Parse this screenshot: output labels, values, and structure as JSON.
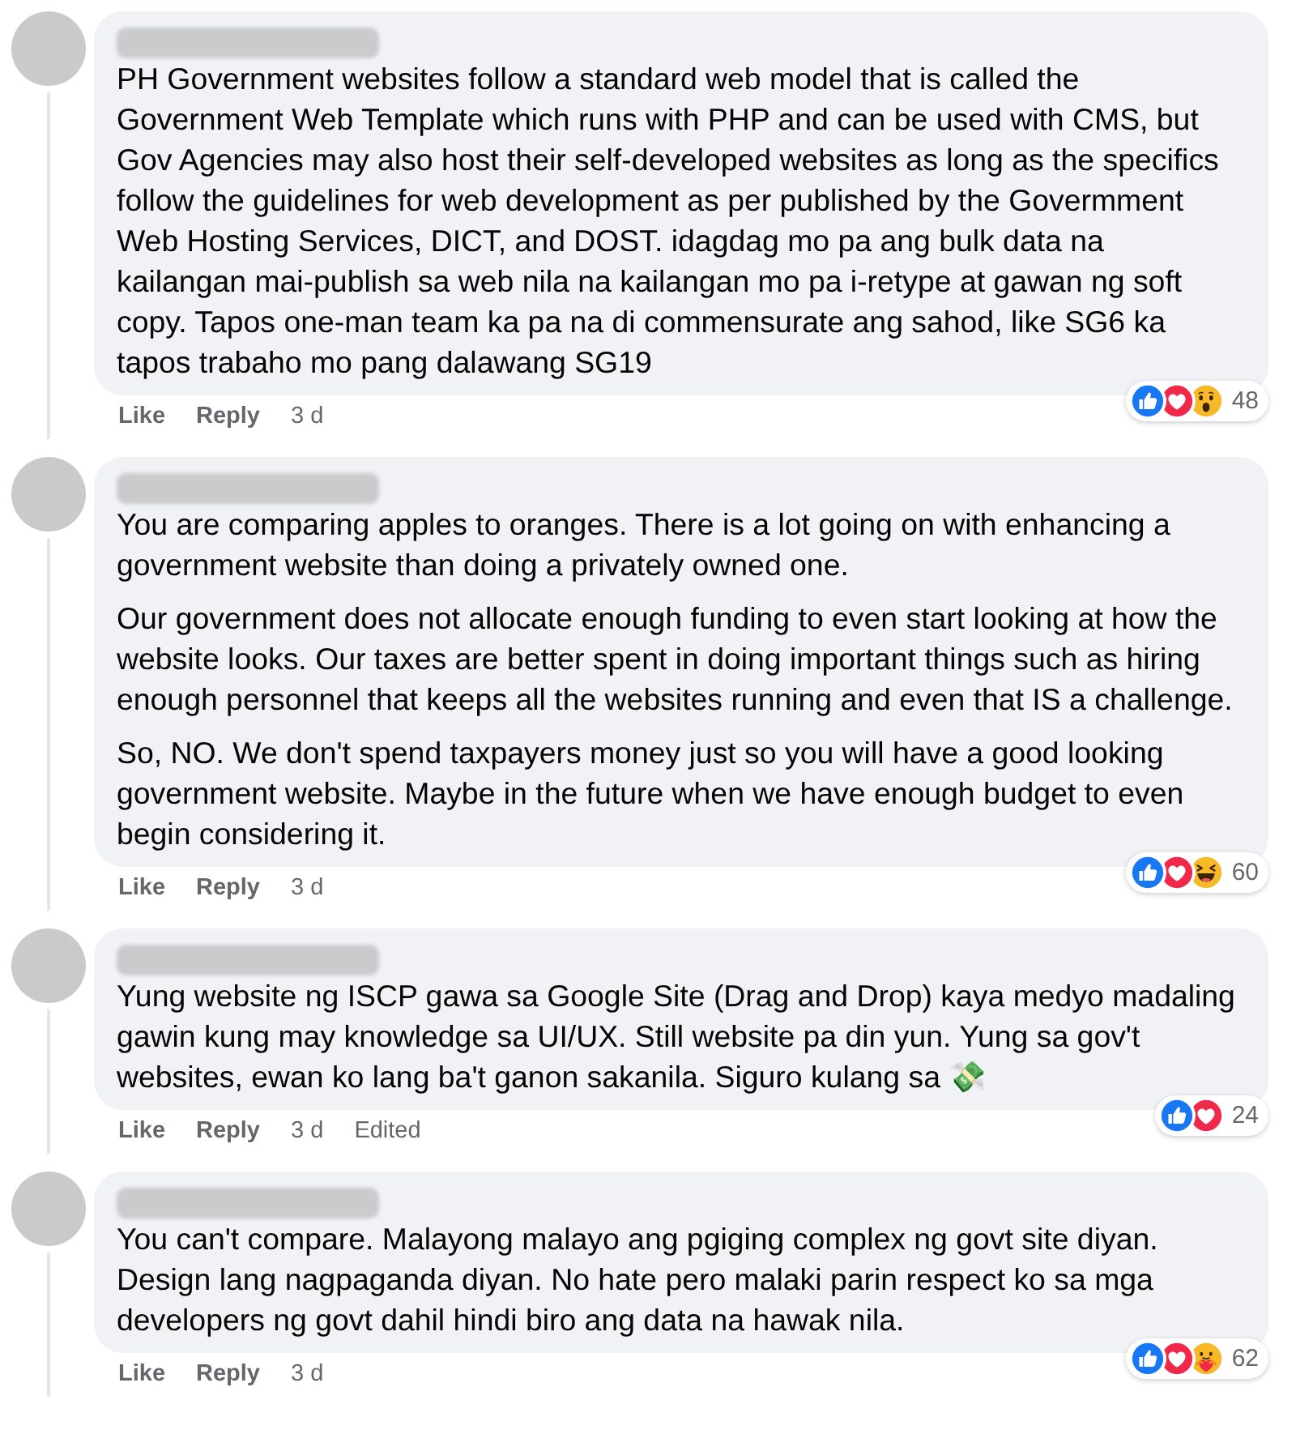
{
  "comments": [
    {
      "paragraphs": [
        {
          "text": "PH Government websites follow a standard web model that is called the Government Web Template which runs with PHP and can be used with CMS, but Gov Agencies may also host their self-developed websites as long as the specifics follow the guidelines for web development as per published by the Govermment Web Hosting Services, DICT, and DOST. idagdag mo pa ang bulk data na kailangan mai-publish sa web nila na kailangan mo pa i-retype at gawan ng soft copy. Tapos one-man team ka pa na di commensurate ang sahod, like SG6 ka tapos trabaho mo pang dalawang SG19"
        }
      ],
      "actions": [
        {
          "label": "Like",
          "kind": "link"
        },
        {
          "label": "Reply",
          "kind": "link"
        },
        {
          "label": "3 d",
          "kind": "meta"
        }
      ],
      "reactions": {
        "items": [
          {
            "kind": "like"
          },
          {
            "kind": "love"
          },
          {
            "kind": "wow"
          }
        ],
        "count": "48"
      }
    },
    {
      "paragraphs": [
        {
          "text": "You are comparing apples to oranges. There is a lot going on with enhancing a government website than doing a privately owned one."
        },
        {
          "text": "Our government does not allocate enough funding to even start looking at how the website looks. Our taxes are better spent in doing important things such as hiring enough personnel that keeps all the websites running and even that IS a challenge."
        },
        {
          "text": "So, NO. We don't spend taxpayers money just so you will have a good looking government website. Maybe in the future when we have enough budget to even begin considering it."
        }
      ],
      "actions": [
        {
          "label": "Like",
          "kind": "link"
        },
        {
          "label": "Reply",
          "kind": "link"
        },
        {
          "label": "3 d",
          "kind": "meta"
        }
      ],
      "reactions": {
        "items": [
          {
            "kind": "like"
          },
          {
            "kind": "love"
          },
          {
            "kind": "haha"
          }
        ],
        "count": "60"
      }
    },
    {
      "paragraphs": [
        {
          "text": "Yung website ng ISCP gawa sa Google Site (Drag and Drop) kaya medyo madaling gawin kung may knowledge sa UI/UX. Still website pa din yun. Yung sa gov't websites, ewan ko lang ba't ganon sakanila. Siguro kulang sa 💸"
        }
      ],
      "actions": [
        {
          "label": "Like",
          "kind": "link"
        },
        {
          "label": "Reply",
          "kind": "link"
        },
        {
          "label": "3 d",
          "kind": "meta"
        },
        {
          "label": "Edited",
          "kind": "meta"
        }
      ],
      "reactions": {
        "items": [
          {
            "kind": "like"
          },
          {
            "kind": "love"
          }
        ],
        "count": "24"
      }
    },
    {
      "paragraphs": [
        {
          "text": "You can't compare. Malayong malayo ang pgiging complex ng govt site diyan. Design lang nagpaganda diyan. No hate pero malaki parin respect ko sa mga developers ng govt dahil hindi biro ang data na hawak nila."
        }
      ],
      "actions": [
        {
          "label": "Like",
          "kind": "link"
        },
        {
          "label": "Reply",
          "kind": "link"
        },
        {
          "label": "3 d",
          "kind": "meta"
        }
      ],
      "reactions": {
        "items": [
          {
            "kind": "like"
          },
          {
            "kind": "love"
          },
          {
            "kind": "care"
          }
        ],
        "count": "62"
      }
    }
  ]
}
